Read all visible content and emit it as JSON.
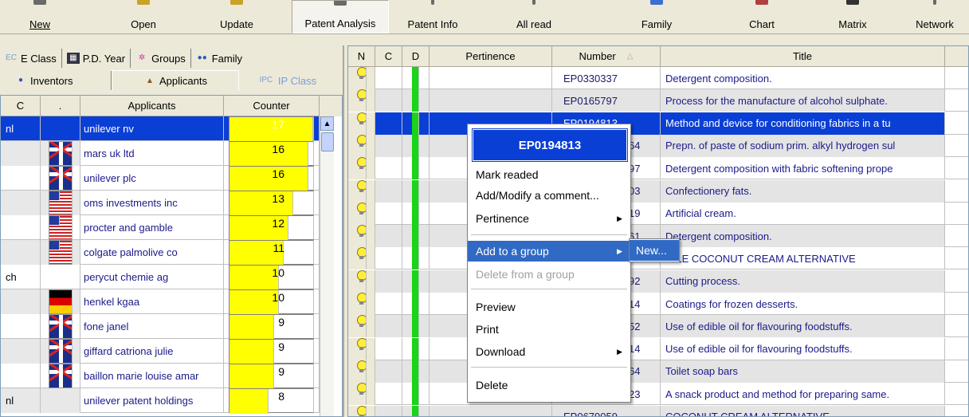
{
  "toolbar": {
    "new": "New",
    "open": "Open",
    "update": "Update",
    "patent_analysis": "Patent Analysis",
    "patent_info": "Patent Info",
    "all_read": "All read",
    "family": "Family",
    "chart": "Chart",
    "matrix": "Matrix",
    "network": "Network"
  },
  "left_tabs": {
    "e_class_icon": "EC",
    "e_class": "E Class",
    "pd_year": "P.D. Year",
    "groups": "Groups",
    "family": "Family",
    "inventors": "Inventors",
    "applicants": "Applicants",
    "ip_class_icon": "IPC",
    "ip_class": "IP Class"
  },
  "applicants_grid": {
    "headers": {
      "c": "C",
      "dot": ".",
      "applicants": "Applicants",
      "counter": "Counter"
    },
    "max_counter": 17,
    "rows": [
      {
        "code": "nl",
        "flag": "",
        "name": "unilever nv",
        "count": "17",
        "value": 17
      },
      {
        "code": "",
        "flag": "uk",
        "name": "mars uk ltd",
        "count": "16",
        "value": 16
      },
      {
        "code": "",
        "flag": "uk",
        "name": "unilever plc",
        "count": "16",
        "value": 16
      },
      {
        "code": "",
        "flag": "us",
        "name": "oms investments inc",
        "count": "13",
        "value": 13
      },
      {
        "code": "",
        "flag": "us",
        "name": "procter and gamble",
        "count": "12",
        "value": 12
      },
      {
        "code": "",
        "flag": "us",
        "name": "colgate palmolive co",
        "count": "11",
        "value": 11
      },
      {
        "code": "ch",
        "flag": "",
        "name": "perycut chemie ag",
        "count": "10",
        "value": 10
      },
      {
        "code": "",
        "flag": "de",
        "name": "henkel kgaa",
        "count": "10",
        "value": 10
      },
      {
        "code": "",
        "flag": "uk",
        "name": "fone janel",
        "count": "9",
        "value": 9
      },
      {
        "code": "",
        "flag": "uk",
        "name": "giffard catriona julie",
        "count": "9",
        "value": 9
      },
      {
        "code": "",
        "flag": "uk",
        "name": "baillon marie louise amar",
        "count": "9",
        "value": 9
      },
      {
        "code": "nl",
        "flag": "",
        "name": "unilever patent holdings",
        "count": "8",
        "value": 8
      }
    ]
  },
  "patents_grid": {
    "headers": {
      "n": "N",
      "c": "C",
      "d": "D",
      "pertinence": "Pertinence",
      "number": "Number",
      "title": "Title"
    },
    "rows": [
      {
        "number": "EP0330337",
        "title": "Detergent composition."
      },
      {
        "number": "EP0165797",
        "title": "Process for the manufacture of alcohol sulphate."
      },
      {
        "number": "EP0194813",
        "title": "Method and device for conditioning fabrics in a tu"
      },
      {
        "number": "64",
        "title": "Prepn. of paste of sodium prim. alkyl hydrogen sul"
      },
      {
        "number": "97",
        "title": "Detergent composition with fabric softening prope"
      },
      {
        "number": "03",
        "title": "Confectionery fats."
      },
      {
        "number": "19",
        "title": "Artificial cream."
      },
      {
        "number": "61",
        "title": "Detergent composition."
      },
      {
        "number": "",
        "title": "ABLE COCONUT CREAM ALTERNATIVE"
      },
      {
        "number": "92",
        "title": "Cutting process."
      },
      {
        "number": "14",
        "title": "Coatings for frozen desserts."
      },
      {
        "number": "52",
        "title": "Use of edible oil for flavouring foodstuffs."
      },
      {
        "number": "14",
        "title": "Use of edible oil for flavouring foodstuffs."
      },
      {
        "number": "64",
        "title": "Toilet soap bars"
      },
      {
        "number": "23",
        "title": "A snack product and method for preparing same."
      },
      {
        "number": "EP0679059",
        "title": "COCONUT CREAM ALTERNATIVE."
      }
    ]
  },
  "context_menu": {
    "header": "EP0194813",
    "mark_readed": "Mark readed",
    "add_modify_comment": "Add/Modify a comment...",
    "pertinence": "Pertinence",
    "add_to_group": "Add to a group",
    "delete_from_group": "Delete from a group",
    "preview": "Preview",
    "print": "Print",
    "download": "Download",
    "delete": "Delete",
    "submenu_new": "New..."
  },
  "colors": {
    "selection": "#0a3fd6",
    "menu_highlight": "#316ac5",
    "counter_bar": "#ffff00",
    "status_square": "#19d419"
  }
}
